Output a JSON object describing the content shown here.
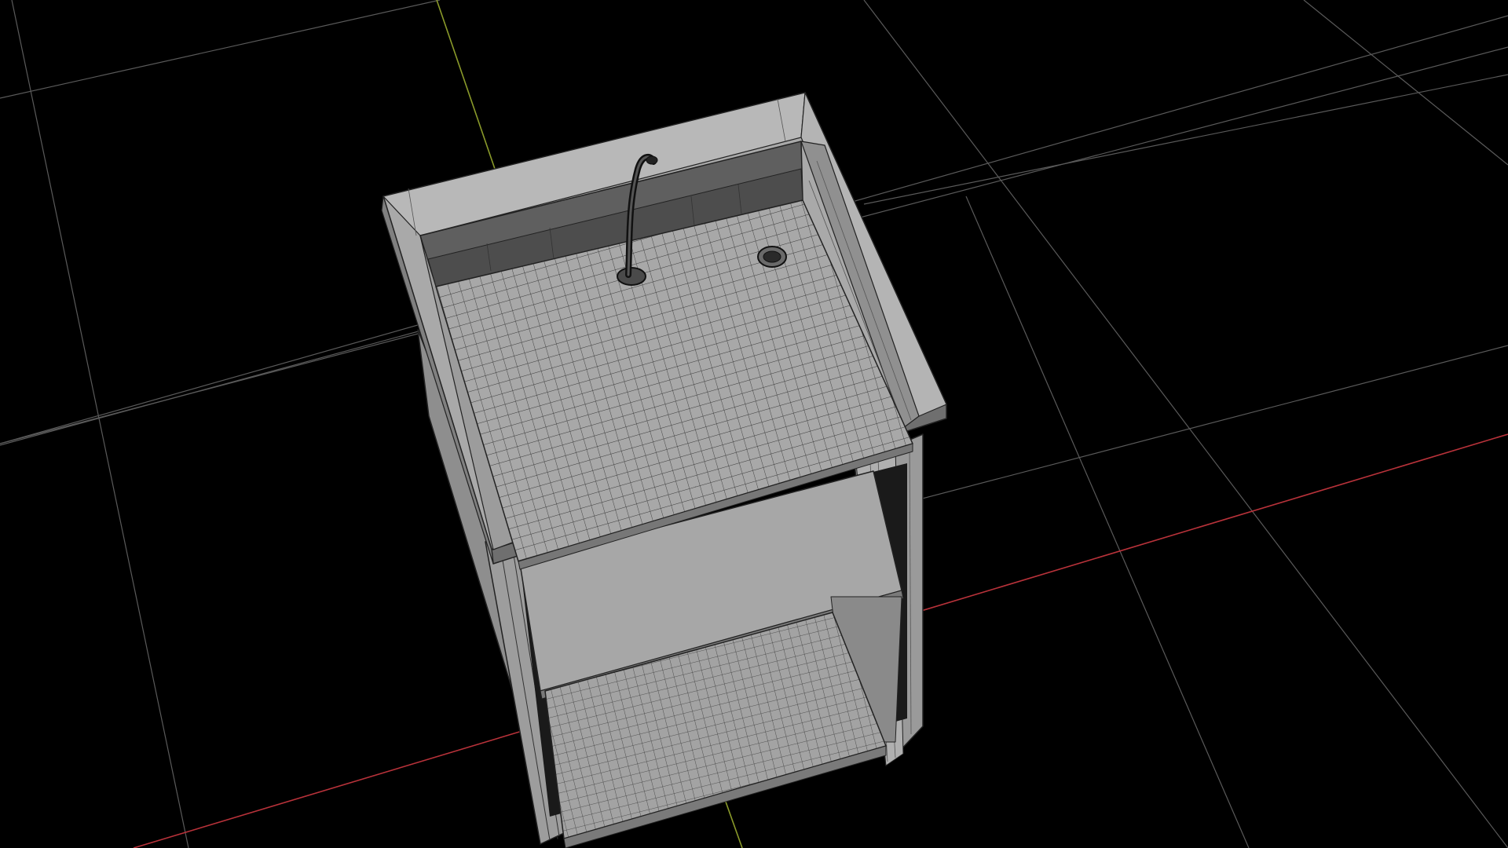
{
  "viewport": {
    "background": "#000000",
    "grid_color": "#5a5a5a",
    "x_axis_color": "#b8323a",
    "y_axis_color": "#8a9a2a"
  },
  "model": {
    "shading": "solid-wireframe",
    "surface_color": "#a6a6a6",
    "surface_light": "#bdbdbd",
    "surface_dark": "#6e6e6e",
    "edge_color": "#222222",
    "parts": [
      "countertop",
      "backsplash",
      "faucet",
      "drain",
      "middle-shelf",
      "bottom-shelf",
      "left-side-panel",
      "right-side-panel"
    ]
  }
}
